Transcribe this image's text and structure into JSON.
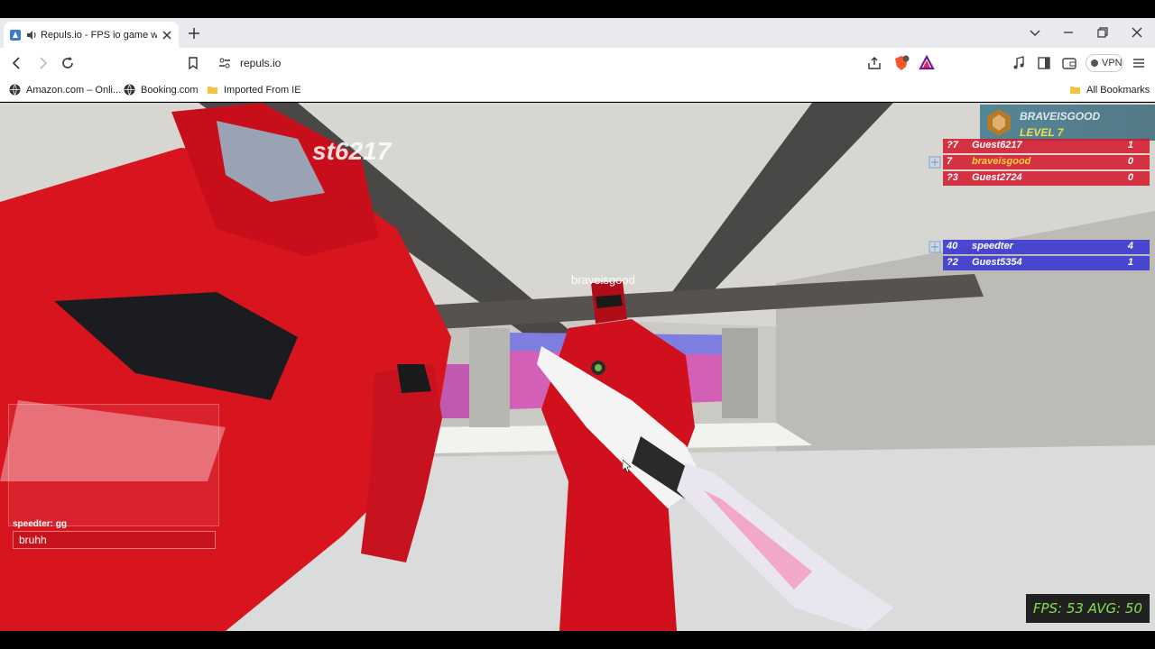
{
  "browser": {
    "tab": {
      "title": "Repuls.io - FPS io game with"
    },
    "address": {
      "url": "repuls.io"
    },
    "toolbar": {
      "vpn_label": "VPN"
    },
    "bookmarks": [
      {
        "label": "Amazon.com – Onli...",
        "icon": "globe-icon"
      },
      {
        "label": "Booking.com",
        "icon": "globe-icon"
      },
      {
        "label": "Imported From IE",
        "icon": "folder-icon"
      }
    ],
    "all_bookmarks": "All Bookmarks"
  },
  "game": {
    "nametags": {
      "enemy_left": "st6217",
      "enemy_center": "braveisgood"
    },
    "player": {
      "name": "BRAVEISGOOD",
      "level": "LEVEL 7"
    },
    "scoreboard": {
      "red_team": [
        {
          "rank": "?7",
          "name": "Guest6217",
          "score": "1"
        },
        {
          "rank": "7",
          "name": "braveisgood",
          "score": "0"
        },
        {
          "rank": "?3",
          "name": "Guest2724",
          "score": "0"
        }
      ],
      "blue_team": [
        {
          "rank": "40",
          "name": "speedter",
          "score": "4"
        },
        {
          "rank": "?2",
          "name": "Guest5354",
          "score": "1"
        }
      ]
    },
    "chat": {
      "last_message": "speedter: gg",
      "input_value": "bruhh"
    },
    "fps": "FPS: 53 AVG: 50",
    "colors": {
      "red_team": "#d3142a",
      "blue_team": "#3b3ad0",
      "self_highlight": "#ffd23c",
      "fps_text": "#7fe04a"
    }
  }
}
